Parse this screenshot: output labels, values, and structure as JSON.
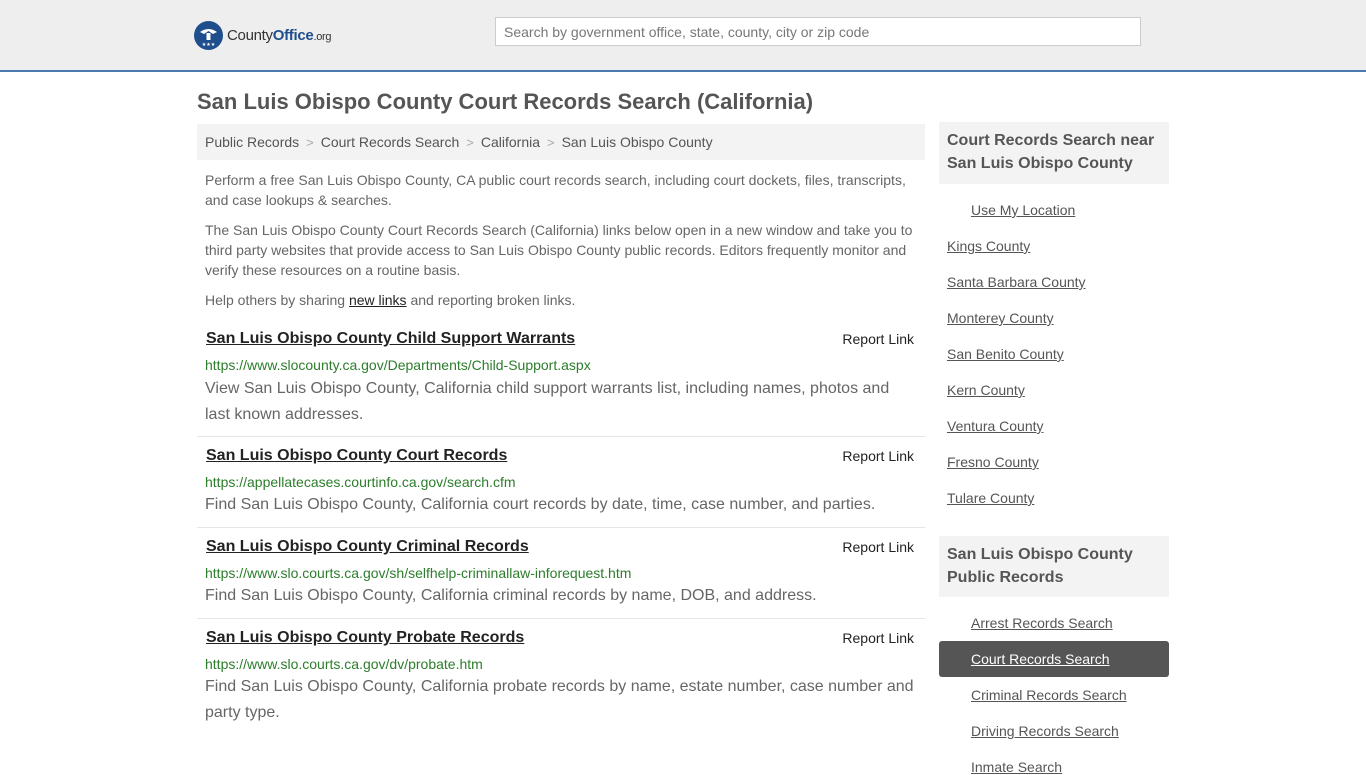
{
  "header": {
    "logo_county": "County",
    "logo_office": "Office",
    "logo_tld": ".org",
    "search_placeholder": "Search by government office, state, county, city or zip code"
  },
  "page_title": "San Luis Obispo County Court Records Search (California)",
  "breadcrumb": [
    "Public Records",
    "Court Records Search",
    "California",
    "San Luis Obispo County"
  ],
  "intro": {
    "p1": "Perform a free San Luis Obispo County, CA public court records search, including court dockets, files, transcripts, and case lookups & searches.",
    "p2": "The San Luis Obispo County Court Records Search (California) links below open in a new window and take you to third party websites that provide access to San Luis Obispo County public records. Editors frequently monitor and verify these resources on a routine basis.",
    "p3_before": "Help others by sharing ",
    "p3_link": "new links",
    "p3_after": " and reporting broken links."
  },
  "report_label": "Report Link",
  "results": [
    {
      "title": "San Luis Obispo County Child Support Warrants",
      "url": "https://www.slocounty.ca.gov/Departments/Child-Support.aspx",
      "desc": "View San Luis Obispo County, California child support warrants list, including names, photos and last known addresses."
    },
    {
      "title": "San Luis Obispo County Court Records",
      "url": "https://appellatecases.courtinfo.ca.gov/search.cfm",
      "desc": "Find San Luis Obispo County, California court records by date, time, case number, and parties."
    },
    {
      "title": "San Luis Obispo County Criminal Records",
      "url": "https://www.slo.courts.ca.gov/sh/selfhelp-criminallaw-inforequest.htm",
      "desc": "Find San Luis Obispo County, California criminal records by name, DOB, and address."
    },
    {
      "title": "San Luis Obispo County Probate Records",
      "url": "https://www.slo.courts.ca.gov/dv/probate.htm",
      "desc": "Find San Luis Obispo County, California probate records by name, estate number, case number and party type."
    }
  ],
  "sidebar": {
    "nearby_heading": "Court Records Search near San Luis Obispo County",
    "use_location": "Use My Location",
    "nearby": [
      "Kings County",
      "Santa Barbara County",
      "Monterey County",
      "San Benito County",
      "Kern County",
      "Ventura County",
      "Fresno County",
      "Tulare County"
    ],
    "records_heading": "San Luis Obispo County Public Records",
    "records": [
      "Arrest Records Search",
      "Court Records Search",
      "Criminal Records Search",
      "Driving Records Search",
      "Inmate Search"
    ],
    "active_record": "Court Records Search"
  },
  "colors": {
    "brand_blue": "#1f4e8c",
    "url_green": "#2c7d2c",
    "active_bg": "#555555"
  }
}
